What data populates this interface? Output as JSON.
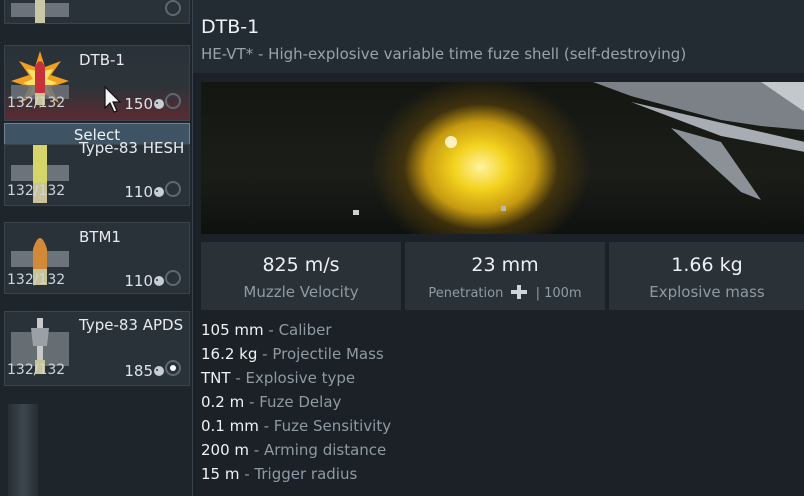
{
  "shell_list": {
    "select_label": "Select",
    "items": [
      {
        "name": "",
        "count": "",
        "price": "",
        "selected": false
      },
      {
        "name": "DTB-1",
        "count": "132/132",
        "price": "150",
        "selected": false,
        "hovered": true
      },
      {
        "name": "Type-83 HESH",
        "count": "132/132",
        "price": "110",
        "selected": false
      },
      {
        "name": "BTM1",
        "count": "132/132",
        "price": "110",
        "selected": false
      },
      {
        "name": "Type-83 APDS",
        "count": "132/132",
        "price": "185",
        "selected": true
      }
    ]
  },
  "info": {
    "title": "DTB-1",
    "subtitle": "HE-VT* - High-explosive variable time fuze shell (self-destroying)",
    "stats": [
      {
        "value": "825 m/s",
        "label": "Muzzle Velocity"
      },
      {
        "value": "23 mm",
        "label_prefix": "Penetration",
        "label_suffix": "| 100m"
      },
      {
        "value": "1.66 kg",
        "label": "Explosive mass"
      }
    ],
    "properties": [
      {
        "value": "105 mm",
        "desc": " - Caliber"
      },
      {
        "value": "16.2 kg",
        "desc": " - Projectile Mass"
      },
      {
        "value": "TNT",
        "desc": " - Explosive type"
      },
      {
        "value": "0.2 m",
        "desc": " - Fuze Delay"
      },
      {
        "value": "0.1 mm",
        "desc": " - Fuze Sensitivity"
      },
      {
        "value": "200 m",
        "desc": " - Arming distance"
      },
      {
        "value": "15 m",
        "desc": " - Trigger radius"
      }
    ]
  },
  "colors": {
    "accent_select": "#3e5363",
    "panel_bg": "#1b2126",
    "explosion": "#f3d21e"
  },
  "icons": {
    "currency": "lion-icon",
    "penetration": "penetration-icon",
    "cursor": "mouse-cursor-icon"
  }
}
